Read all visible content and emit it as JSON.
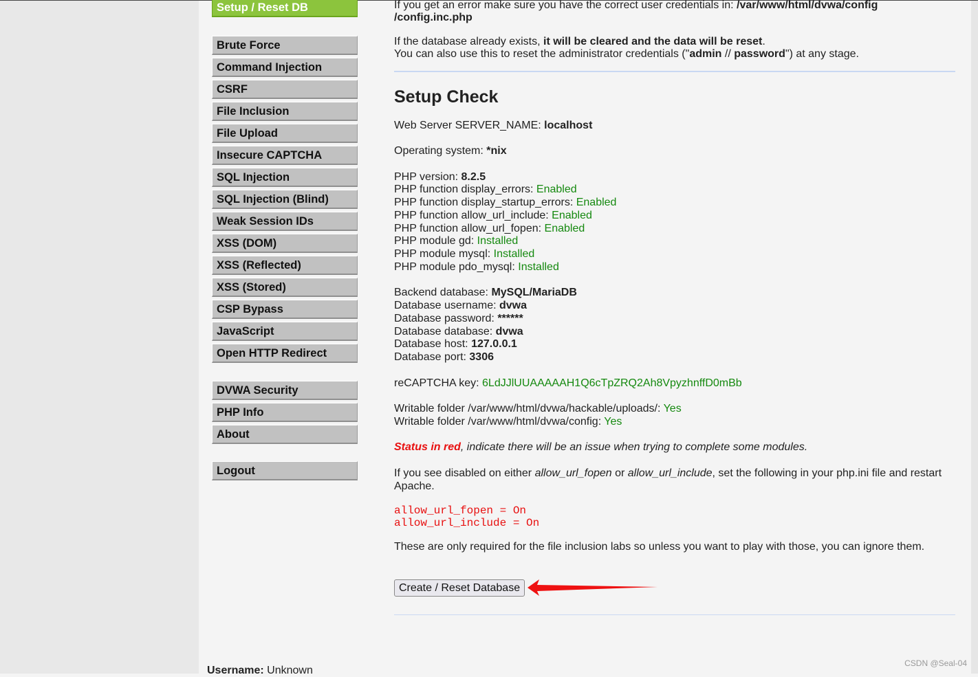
{
  "sidebar": {
    "active": "Setup / Reset DB",
    "group1": [
      "Brute Force",
      "Command Injection",
      "CSRF",
      "File Inclusion",
      "File Upload",
      "Insecure CAPTCHA",
      "SQL Injection",
      "SQL Injection (Blind)",
      "Weak Session IDs",
      "XSS (DOM)",
      "XSS (Reflected)",
      "XSS (Stored)",
      "CSP Bypass",
      "JavaScript",
      "Open HTTP Redirect"
    ],
    "group2": [
      "DVWA Security",
      "PHP Info",
      "About"
    ],
    "logout": "Logout"
  },
  "intro": {
    "l1": "If you get an error make sure you have the correct user credentials in: ",
    "l1b": "/var/www/html/dvwa/config",
    "l2": "/config.inc.php",
    "l3a": "If the database already exists, ",
    "l3b": "it will be cleared and the data will be reset",
    "l4a": "You can also use this to reset the administrator credentials (\"",
    "l4b": "admin",
    "l4c": " // ",
    "l4d": "password",
    "l4e": "\") at any stage."
  },
  "setup_check": {
    "title": "Setup Check",
    "rows": [
      {
        "label": "Web Server SERVER_NAME: ",
        "value": "localhost",
        "style": "b"
      },
      {
        "label": "Operating system: ",
        "value": "*nix",
        "style": "b"
      },
      {
        "label": "PHP version: ",
        "value": "8.2.5",
        "style": "b"
      },
      {
        "label": "PHP function display_errors: ",
        "value": "Enabled",
        "style": "g"
      },
      {
        "label": "PHP function display_startup_errors: ",
        "value": "Enabled",
        "style": "g"
      },
      {
        "label": "PHP function allow_url_include: ",
        "value": "Enabled",
        "style": "g"
      },
      {
        "label": "PHP function allow_url_fopen: ",
        "value": "Enabled",
        "style": "g"
      },
      {
        "label": "PHP module gd: ",
        "value": "Installed",
        "style": "g"
      },
      {
        "label": "PHP module mysql: ",
        "value": "Installed",
        "style": "g"
      },
      {
        "label": "PHP module pdo_mysql: ",
        "value": "Installed",
        "style": "g"
      },
      {
        "label": "Backend database: ",
        "value": "MySQL/MariaDB",
        "style": "b"
      },
      {
        "label": "Database username: ",
        "value": "dvwa",
        "style": "b"
      },
      {
        "label": "Database password: ",
        "value": "******",
        "style": "b"
      },
      {
        "label": "Database database: ",
        "value": "dvwa",
        "style": "b"
      },
      {
        "label": "Database host: ",
        "value": "127.0.0.1",
        "style": "b"
      },
      {
        "label": "Database port: ",
        "value": "3306",
        "style": "b"
      },
      {
        "label": "reCAPTCHA key: ",
        "value": "6LdJJlUUAAAAAH1Q6cTpZRQ2Ah8VpyzhnffD0mBb",
        "style": "g"
      },
      {
        "label": "Writable folder /var/www/html/dvwa/hackable/uploads/: ",
        "value": "Yes",
        "style": "g"
      },
      {
        "label": "Writable folder /var/www/html/dvwa/config: ",
        "value": "Yes",
        "style": "g"
      }
    ],
    "status_a": "Status in red",
    "status_b": ", indicate there will be an issue when trying to complete some modules.",
    "dis_a": "If you see disabled on either ",
    "dis_b": "allow_url_fopen",
    "dis_c": " or ",
    "dis_d": "allow_url_include",
    "dis_e": ", set the following in your php.ini file and restart",
    "dis_f": "Apache.",
    "code1": "allow_url_fopen = On",
    "code2": "allow_url_include = On",
    "note": "These are only required for the file inclusion labs so unless you want to play with those, you can ignore them.",
    "button": "Create / Reset Database"
  },
  "footer": {
    "username_label": "Username:",
    "username": "Unknown"
  },
  "watermark": "CSDN @Seal-04",
  "colors": {
    "active_nav": "#8cc43d",
    "ok": "#15890f",
    "error": "#e81010",
    "arrow": "#ee1111"
  }
}
